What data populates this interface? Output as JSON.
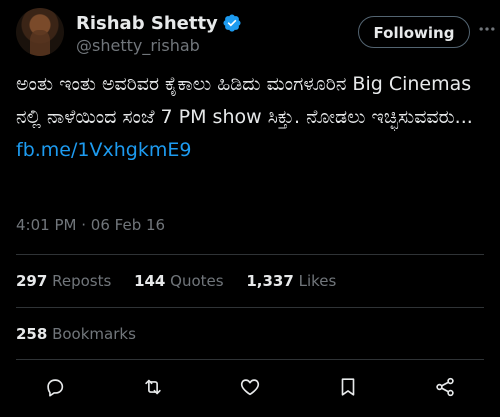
{
  "author": {
    "name": "Rishab Shetty",
    "handle": "@shetty_rishab",
    "verified": true
  },
  "follow_label": "Following",
  "tweet": {
    "text_before_link": "ಅಂತು ಇಂತು ಅವರಿವರ ಕೈಕಾಲು ಹಿಡಿದು ಮಂಗಳೂರಿನ Big Cinemas ನಲ್ಲಿ ನಾಳೆಯಿಂದ ಸಂಜೆ 7 PM show ಸಿಕ್ತು. ನೋಡಲು ಇಚ್ಛಿಸುವವರು... ",
    "link_text": "fb.me/1VxhgkmE9"
  },
  "meta": {
    "time": "4:01 PM",
    "separator": "·",
    "date": "06 Feb 16"
  },
  "stats": {
    "reposts_count": "297",
    "reposts_label": "Reposts",
    "quotes_count": "144",
    "quotes_label": "Quotes",
    "likes_count": "1,337",
    "likes_label": "Likes",
    "bookmarks_count": "258",
    "bookmarks_label": "Bookmarks"
  },
  "icons": {
    "verified": "verified-badge-icon",
    "more": "more-dots-icon",
    "reply": "reply-icon",
    "repost": "repost-icon",
    "like": "heart-icon",
    "bookmark": "bookmark-icon",
    "share": "share-icon"
  },
  "colors": {
    "background": "#000000",
    "text": "#e7e9ea",
    "secondary": "#71767b",
    "link": "#1d9bf0",
    "divider": "#2f3336",
    "verified": "#1d9bf0"
  }
}
